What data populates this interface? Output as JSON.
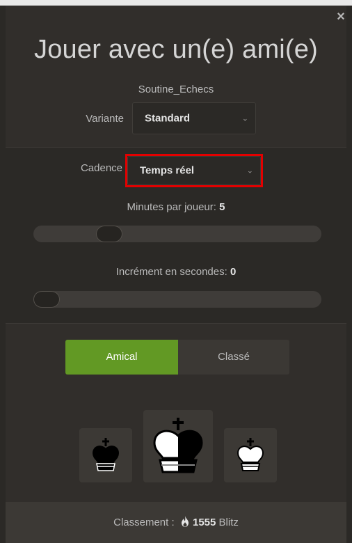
{
  "dialog": {
    "title": "Jouer avec un(e) ami(e)",
    "close_glyph": "×",
    "username": "Soutine_Echecs"
  },
  "variant": {
    "label": "Variante",
    "value": "Standard",
    "chevron": "⌄"
  },
  "cadence": {
    "label": "Cadence",
    "value": "Temps réel",
    "chevron": "⌄"
  },
  "minutes": {
    "label": "Minutes par joueur:",
    "value": "5"
  },
  "increment": {
    "label": "Incrément en secondes:",
    "value": "0"
  },
  "mode": {
    "casual": "Amical",
    "rated": "Classé",
    "selected": "casual"
  },
  "colors": {
    "accent_green": "#629924",
    "highlight_red": "#e30000"
  },
  "pieces": [
    {
      "name": "black-king-icon",
      "color": "black"
    },
    {
      "name": "random-king-icon",
      "color": "random"
    },
    {
      "name": "white-king-icon",
      "color": "white"
    }
  ],
  "rating": {
    "label": "Classement :",
    "icon": "flame-icon",
    "value": "1555",
    "category": "Blitz"
  }
}
